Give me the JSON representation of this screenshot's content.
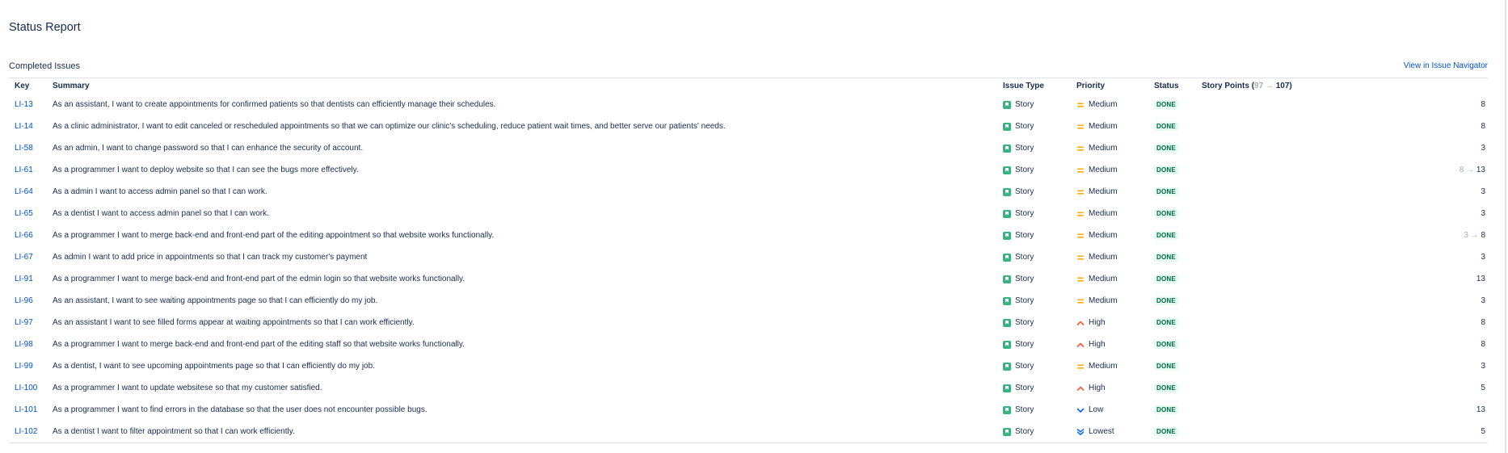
{
  "page": {
    "title": "Status Report"
  },
  "section": {
    "title": "Completed Issues",
    "navigator_link": "View in Issue Navigator"
  },
  "columns": {
    "key": "Key",
    "summary": "Summary",
    "issue_type": "Issue Type",
    "priority": "Priority",
    "status": "Status",
    "story_points": {
      "label": "Story Points",
      "open_paren": "(",
      "old": "97",
      "arrow": "→",
      "new": "107",
      "close_paren": ")"
    }
  },
  "colors": {
    "link": "#0052cc",
    "story_icon": "#36b37e",
    "medium_priority": "#ffab00",
    "high_priority": "#ff5630",
    "low_priority": "#0065ff",
    "done_badge_bg": "#e3fcef",
    "done_badge_text": "#006644"
  },
  "rows": [
    {
      "key": "LI-13",
      "summary": "As an assistant, I want to create appointments for confirmed patients so that dentists can efficiently manage their schedules.",
      "issue_type": "Story",
      "type_icon": "story-icon",
      "priority": "Medium",
      "priority_icon": "medium-priority-icon",
      "status": "DONE",
      "points": "8"
    },
    {
      "key": "LI-14",
      "summary": "As a clinic administrator, I want to edit canceled or rescheduled appointments so that we can optimize our clinic's scheduling, reduce patient wait times, and better serve our patients' needs.",
      "issue_type": "Story",
      "type_icon": "story-icon",
      "priority": "Medium",
      "priority_icon": "medium-priority-icon",
      "status": "DONE",
      "points": "8"
    },
    {
      "key": "LI-58",
      "summary": "As an admin, I want to change password so that I can enhance the security of account.",
      "issue_type": "Story",
      "type_icon": "story-icon",
      "priority": "Medium",
      "priority_icon": "medium-priority-icon",
      "status": "DONE",
      "points": "3"
    },
    {
      "key": "LI-61",
      "summary": "As a programmer I want to deploy website so that I can see the bugs more effectively.",
      "issue_type": "Story",
      "type_icon": "story-icon",
      "priority": "Medium",
      "priority_icon": "medium-priority-icon",
      "status": "DONE",
      "points": "13",
      "points_old": "8",
      "points_arrow": "→"
    },
    {
      "key": "LI-64",
      "summary": "As a admin I want to access admin panel so that I can work.",
      "issue_type": "Story",
      "type_icon": "story-icon",
      "priority": "Medium",
      "priority_icon": "medium-priority-icon",
      "status": "DONE",
      "points": "3"
    },
    {
      "key": "LI-65",
      "summary": "As a dentist I want to access admin panel so that I can work.",
      "issue_type": "Story",
      "type_icon": "story-icon",
      "priority": "Medium",
      "priority_icon": "medium-priority-icon",
      "status": "DONE",
      "points": "3"
    },
    {
      "key": "LI-66",
      "summary": "As a programmer I want to merge back-end and front-end part of the editing appointment so that website works functionally.",
      "issue_type": "Story",
      "type_icon": "story-icon",
      "priority": "Medium",
      "priority_icon": "medium-priority-icon",
      "status": "DONE",
      "points": "8",
      "points_old": "3",
      "points_arrow": "→"
    },
    {
      "key": "LI-67",
      "summary": "As admin I want to add price in appointments so that I can track my customer's payment",
      "issue_type": "Story",
      "type_icon": "story-icon",
      "priority": "Medium",
      "priority_icon": "medium-priority-icon",
      "status": "DONE",
      "points": "3"
    },
    {
      "key": "LI-91",
      "summary": "As a programmer I want to merge back-end and front-end part of the edmin login so that website works functionally.",
      "issue_type": "Story",
      "type_icon": "story-icon",
      "priority": "Medium",
      "priority_icon": "medium-priority-icon",
      "status": "DONE",
      "points": "13"
    },
    {
      "key": "LI-96",
      "summary": "As an assistant, I want to see waiting appointments page so that I can efficiently do my job.",
      "issue_type": "Story",
      "type_icon": "story-icon",
      "priority": "Medium",
      "priority_icon": "medium-priority-icon",
      "status": "DONE",
      "points": "3"
    },
    {
      "key": "LI-97",
      "summary": "As an assistant I want to see filled forms appear at waiting appointments so that I can work efficiently.",
      "issue_type": "Story",
      "type_icon": "story-icon",
      "priority": "High",
      "priority_icon": "high-priority-icon",
      "status": "DONE",
      "points": "8"
    },
    {
      "key": "LI-98",
      "summary": "As a programmer I want to merge back-end and front-end part of the editing staff so that website works functionally.",
      "issue_type": "Story",
      "type_icon": "story-icon",
      "priority": "High",
      "priority_icon": "high-priority-icon",
      "status": "DONE",
      "points": "8"
    },
    {
      "key": "LI-99",
      "summary": "As a dentist, I want to see upcoming appointments page so that I can efficiently do my job.",
      "issue_type": "Story",
      "type_icon": "story-icon",
      "priority": "Medium",
      "priority_icon": "medium-priority-icon",
      "status": "DONE",
      "points": "3"
    },
    {
      "key": "LI-100",
      "summary": "As a programmer I want to update websitese so that my customer satisfied.",
      "issue_type": "Story",
      "type_icon": "story-icon",
      "priority": "High",
      "priority_icon": "high-priority-icon",
      "status": "DONE",
      "points": "5"
    },
    {
      "key": "LI-101",
      "summary": "As a programmer I want to find errors in the database so that the user does not encounter possible bugs.",
      "issue_type": "Story",
      "type_icon": "story-icon",
      "priority": "Low",
      "priority_icon": "low-priority-icon",
      "status": "DONE",
      "points": "13"
    },
    {
      "key": "LI-102",
      "summary": "As a dentist I want to filter appointment so that I can work efficiently.",
      "issue_type": "Story",
      "type_icon": "story-icon",
      "priority": "Lowest",
      "priority_icon": "lowest-priority-icon",
      "status": "DONE",
      "points": "5"
    }
  ]
}
